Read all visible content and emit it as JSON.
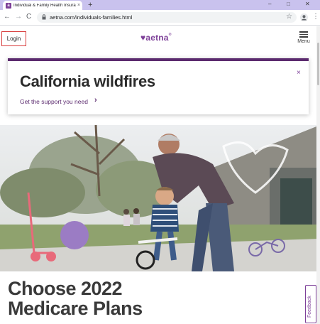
{
  "browser": {
    "tab_title": "Individual & Family Health Insura",
    "favicon_letter": "a",
    "tab_close": "×",
    "new_tab": "+",
    "url": "aetna.com/individuals-families.html",
    "back": "←",
    "forward": "→",
    "reload": "C",
    "star": "☆",
    "more": "⋮",
    "minimize": "–",
    "maximize": "□",
    "close": "✕"
  },
  "header": {
    "login_label": "Login",
    "logo_heart": "♥",
    "logo_text": "aetna",
    "logo_tm": "®",
    "menu_label": "Menu"
  },
  "alert": {
    "title": "California wildfires",
    "link": "Get the support you need",
    "chevron": "›",
    "close": "×"
  },
  "hero": {
    "heading_line1": "Choose 2022",
    "heading_line2": "Medicare Plans"
  },
  "feedback": {
    "label": "Feedback"
  },
  "colors": {
    "brand": "#7d3f98",
    "alert_bar": "#5b2a6e",
    "tab_strip": "#c9c2ee",
    "login_border": "#d83b3b"
  }
}
